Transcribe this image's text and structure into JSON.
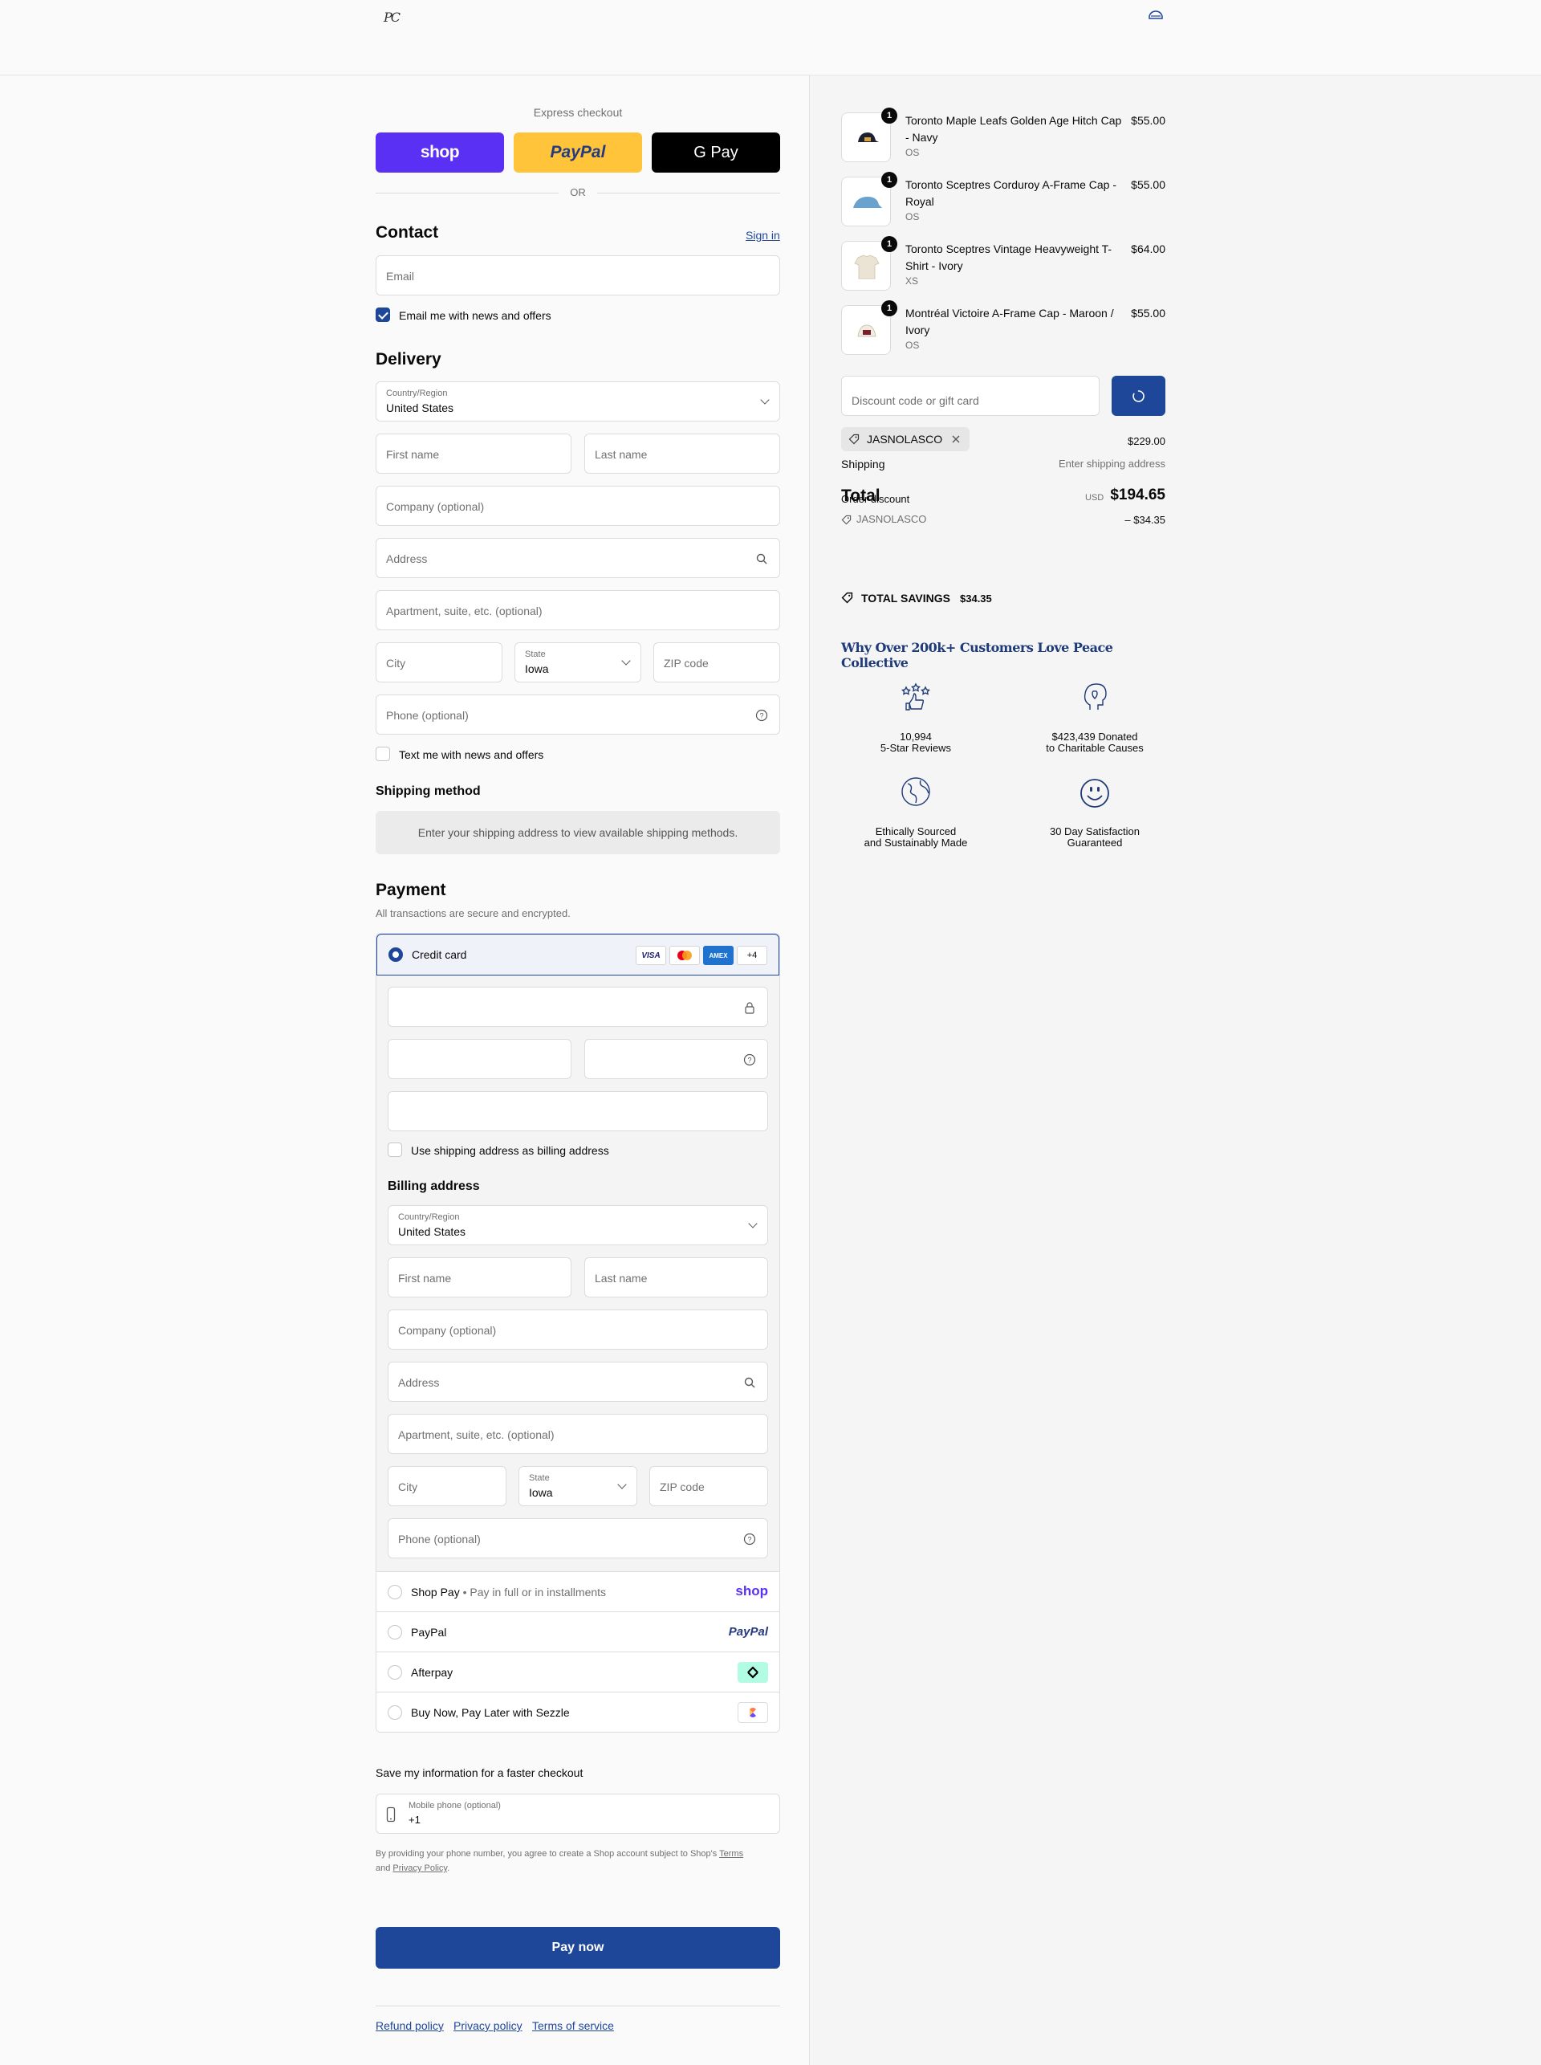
{
  "header": {
    "logo_text": "PC"
  },
  "express": {
    "title": "Express checkout",
    "shop_label": "shop",
    "paypal_label": "PayPal",
    "gpay_label": "G Pay",
    "or_label": "OR"
  },
  "contact": {
    "title": "Contact",
    "sign_in": "Sign in",
    "email_placeholder": "Email",
    "email_news": "Email me with news and offers"
  },
  "delivery": {
    "title": "Delivery",
    "country_label": "Country/Region",
    "country_value": "United States",
    "first_name": "First name",
    "last_name": "Last name",
    "company": "Company (optional)",
    "address": "Address",
    "apartment": "Apartment, suite, etc. (optional)",
    "city": "City",
    "state_label": "State",
    "state_value": "Iowa",
    "zip": "ZIP code",
    "phone": "Phone (optional)",
    "text_news": "Text me with news and offers"
  },
  "shipping_method": {
    "title": "Shipping method",
    "message": "Enter your shipping address to view available shipping methods."
  },
  "payment": {
    "title": "Payment",
    "subtitle": "All transactions are secure and encrypted.",
    "credit_card": "Credit card",
    "more_cards": "+4",
    "use_shipping": "Use shipping address as billing address",
    "billing_title": "Billing address",
    "shop_pay": "Shop Pay",
    "shop_pay_sub": "Pay in full or in installments",
    "shop_pay_logo": "shop",
    "paypal": "PayPal",
    "afterpay": "Afterpay",
    "sezzle": "Buy Now, Pay Later with Sezzle"
  },
  "save_info": {
    "title": "Save my information for a faster checkout",
    "mobile_label": "Mobile phone (optional)",
    "mobile_value": "+1",
    "legal_pre": "By providing your phone number, you agree to create a Shop account subject to Shop's",
    "terms": "Terms",
    "and": "and",
    "privacy": "Privacy Policy",
    "period": "."
  },
  "pay_now": "Pay now",
  "footer": {
    "refund": "Refund policy",
    "privacy": "Privacy policy",
    "terms": "Terms of service"
  },
  "cart": {
    "items": [
      {
        "qty": "1",
        "name": "Toronto Maple Leafs Golden Age Hitch Cap - Navy",
        "variant": "OS",
        "price": "$55.00"
      },
      {
        "qty": "1",
        "name": "Toronto Sceptres Corduroy A-Frame Cap - Royal",
        "variant": "OS",
        "price": "$55.00"
      },
      {
        "qty": "1",
        "name": "Toronto Sceptres Vintage Heavyweight T-Shirt - Ivory",
        "variant": "XS",
        "price": "$64.00"
      },
      {
        "qty": "1",
        "name": "Montréal Victoire A-Frame Cap - Maroon / Ivory",
        "variant": "OS",
        "price": "$55.00"
      }
    ],
    "discount_placeholder": "Discount code or gift card",
    "applied_code": "JASNOLASCO",
    "subtotal": "$229.00",
    "shipping_label": "Shipping",
    "shipping_value": "Enter shipping address",
    "total_label": "Total",
    "order_discount_label": "Order discount",
    "currency": "USD",
    "total_value": "$194.65",
    "discount_code": "JASNOLASCO",
    "discount_value": "– $34.35",
    "savings_label": "TOTAL SAVINGS",
    "savings_value": "$34.35"
  },
  "trust": {
    "title": "Why Over 200k+ Customers Love Peace Collective",
    "items": [
      {
        "line1": "10,994",
        "line2": "5-Star Reviews"
      },
      {
        "line1": "$423,439 Donated",
        "line2": "to Charitable Causes"
      },
      {
        "line1": "Ethically Sourced",
        "line2": "and Sustainably Made"
      },
      {
        "line1": "30 Day Satisfaction",
        "line2": "Guaranteed"
      }
    ]
  },
  "colors": {
    "primary": "#1f4799",
    "shop": "#5a31f4",
    "paypal": "#ffc439",
    "gpay": "#000000"
  }
}
